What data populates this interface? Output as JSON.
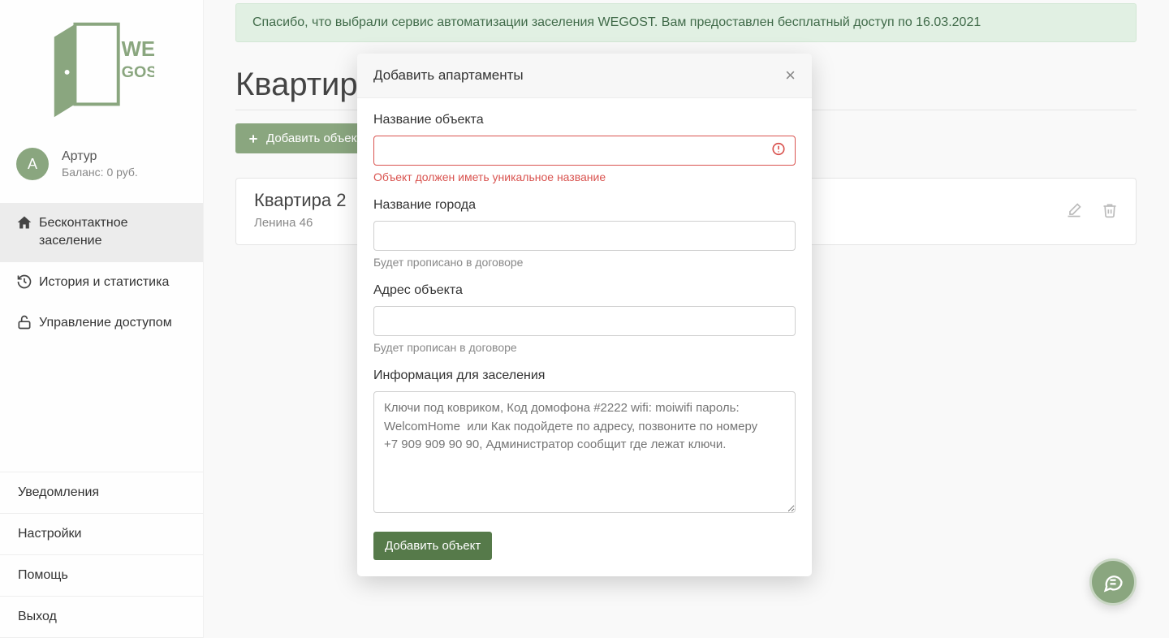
{
  "user": {
    "initial": "А",
    "name": "Артур",
    "balance_label": "Баланс: 0 руб."
  },
  "nav": {
    "main": [
      {
        "label": "Бесконтактное заселение",
        "icon": "home-icon",
        "active": true
      },
      {
        "label": "История и статистика",
        "icon": "history-icon",
        "active": false
      },
      {
        "label": "Управление доступом",
        "icon": "unlock-icon",
        "active": false
      }
    ],
    "bottom": [
      {
        "label": "Уведомления"
      },
      {
        "label": "Настройки"
      },
      {
        "label": "Помощь"
      },
      {
        "label": "Выход"
      }
    ]
  },
  "banner": "Спасибо, что выбрали сервис автоматизации заселения WEGOST. Вам предоставлен бесплатный доступ по 16.03.2021",
  "page": {
    "title": "Квартиры",
    "add_button": "Добавить объект"
  },
  "apartments": [
    {
      "title": "Квартира 2",
      "address": "Ленина 46"
    }
  ],
  "modal": {
    "title": "Добавить апартаменты",
    "fields": {
      "name_label": "Название объекта",
      "name_error": "Объект должен иметь уникальное название",
      "city_label": "Название города",
      "city_helper": "Будет прописано в договоре",
      "address_label": "Адрес объекта",
      "address_helper": "Будет прописан в договоре",
      "info_label": "Информация для заселения",
      "info_placeholder": "Ключи под ковриком, Код домофона #2222 wifi: moiwifi пароль: WelcomHome  или Как подойдете по адресу, позвоните по номеру +7 909 909 90 90, Администратор сообщит где лежат ключи.",
      "submit": "Добавить объект"
    }
  },
  "colors": {
    "accent": "#8aa67f",
    "banner_bg": "#e1f0e3",
    "error": "#d9534f"
  }
}
